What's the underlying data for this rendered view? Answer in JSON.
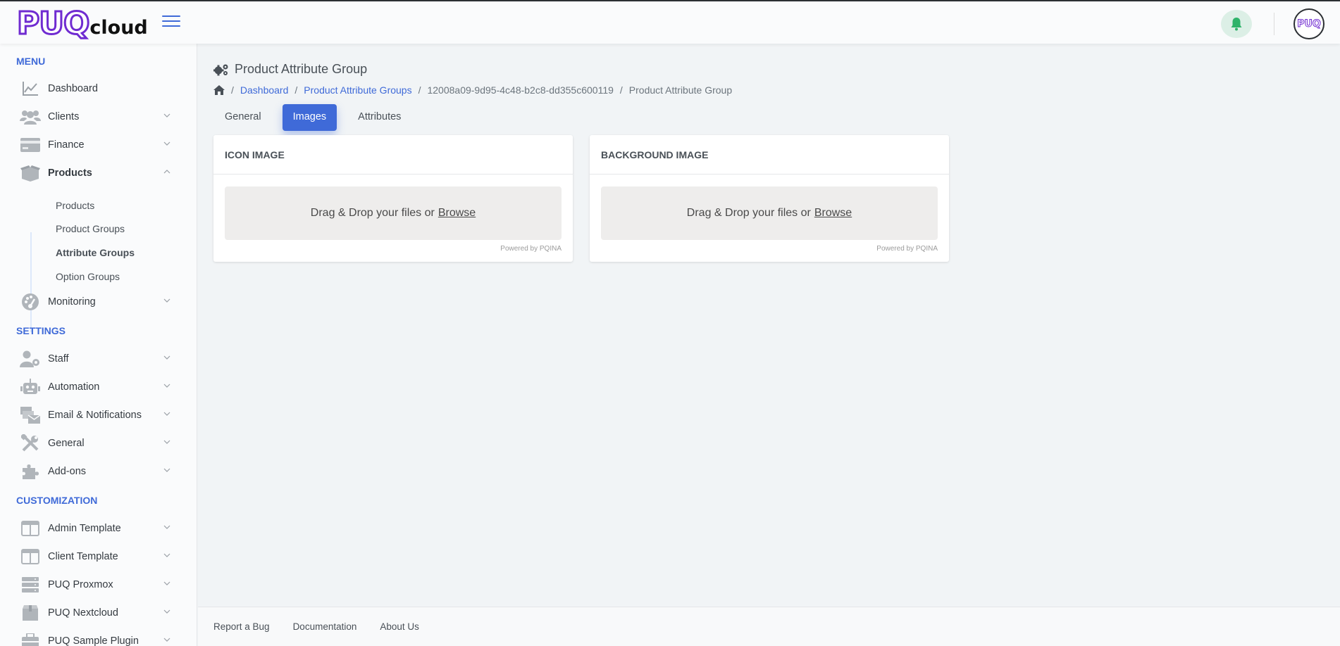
{
  "header": {
    "logo_main": "PUQ",
    "logo_sub": "cloud",
    "avatar_text": "PUQ"
  },
  "sidebar": {
    "sections": {
      "menu": "MENU",
      "settings": "SETTINGS",
      "customization": "CUSTOMIZATION"
    },
    "items": {
      "dashboard": "Dashboard",
      "clients": "Clients",
      "finance": "Finance",
      "products": "Products",
      "monitoring": "Monitoring",
      "staff": "Staff",
      "automation": "Automation",
      "email_notifications": "Email & Notifications",
      "general": "General",
      "addons": "Add-ons",
      "admin_template": "Admin Template",
      "client_template": "Client Template",
      "puq_proxmox": "PUQ Proxmox",
      "puq_nextcloud": "PUQ Nextcloud",
      "puq_sample_plugin": "PUQ Sample Plugin"
    },
    "products_sub": {
      "products": "Products",
      "product_groups": "Product Groups",
      "attribute_groups": "Attribute Groups",
      "option_groups": "Option Groups"
    }
  },
  "page": {
    "title": "Product Attribute Group",
    "breadcrumb": {
      "dashboard": "Dashboard",
      "groups": "Product Attribute Groups",
      "id": "12008a09-9d95-4c48-b2c8-dd355c600119",
      "current": "Product Attribute Group"
    },
    "tabs": {
      "general": "General",
      "images": "Images",
      "attributes": "Attributes"
    },
    "cards": {
      "icon": {
        "title": "ICON IMAGE",
        "drop_text": "Drag & Drop your files or",
        "browse": "Browse",
        "powered": "Powered by PQINA"
      },
      "background": {
        "title": "BACKGROUND IMAGE",
        "drop_text": "Drag & Drop your files or",
        "browse": "Browse",
        "powered": "Powered by PQINA"
      }
    }
  },
  "footer": {
    "report_bug": "Report a Bug",
    "documentation": "Documentation",
    "about": "About Us"
  },
  "colors": {
    "accent": "#3f6ad8",
    "brand": "#6f2bd1",
    "bell": "#2fb36a"
  }
}
